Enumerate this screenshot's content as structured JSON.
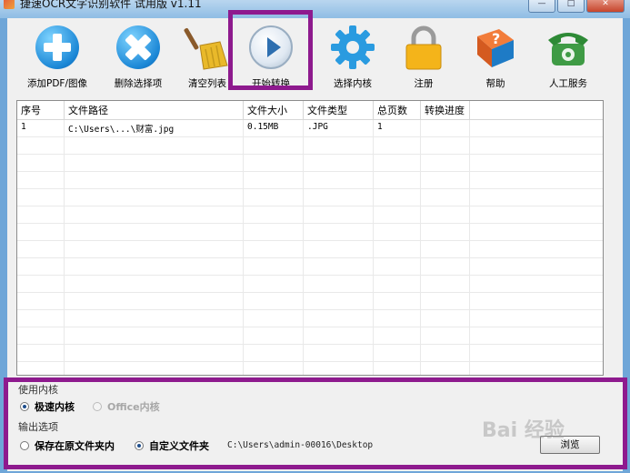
{
  "window": {
    "title": "捷速OCR文字识别软件 试用版 v1.11",
    "controls": [
      "—",
      "□",
      "✕"
    ]
  },
  "toolbar": {
    "buttons": [
      {
        "label": "添加PDF/图像",
        "icon": "add-icon"
      },
      {
        "label": "删除选择项",
        "icon": "delete-icon"
      },
      {
        "label": "清空列表",
        "icon": "broom-icon"
      },
      {
        "label": "开始转换",
        "icon": "play-icon"
      },
      {
        "label": "选择内核",
        "icon": "gear-icon"
      },
      {
        "label": "注册",
        "icon": "lock-icon"
      },
      {
        "label": "帮助",
        "icon": "help-book-icon"
      },
      {
        "label": "人工服务",
        "icon": "phone-icon"
      }
    ],
    "highlighted": "开始转换"
  },
  "table": {
    "columns": [
      "序号",
      "文件路径",
      "文件大小",
      "文件类型",
      "总页数",
      "转换进度",
      ""
    ],
    "rows": [
      [
        "1",
        "C:\\Users\\...\\财富.jpg",
        "0.15MB",
        ".JPG",
        "1",
        "",
        ""
      ]
    ]
  },
  "options": {
    "kernel_label": "使用内核",
    "kernel_options": [
      {
        "label": "极速内核",
        "selected": true,
        "enabled": true
      },
      {
        "label": "Office内核",
        "selected": false,
        "enabled": false
      }
    ],
    "output_label": "输出选项",
    "output_options": [
      {
        "label": "保存在原文件夹内",
        "selected": false
      },
      {
        "label": "自定义文件夹",
        "selected": true
      }
    ],
    "output_path": "C:\\Users\\admin-00016\\Desktop",
    "browse_label": "浏览"
  },
  "watermark": "Bai 经验",
  "colors": {
    "highlight": "#8e1a8e",
    "titlebar": "#9cc4e8",
    "accent_blue": "#1b87d6"
  }
}
